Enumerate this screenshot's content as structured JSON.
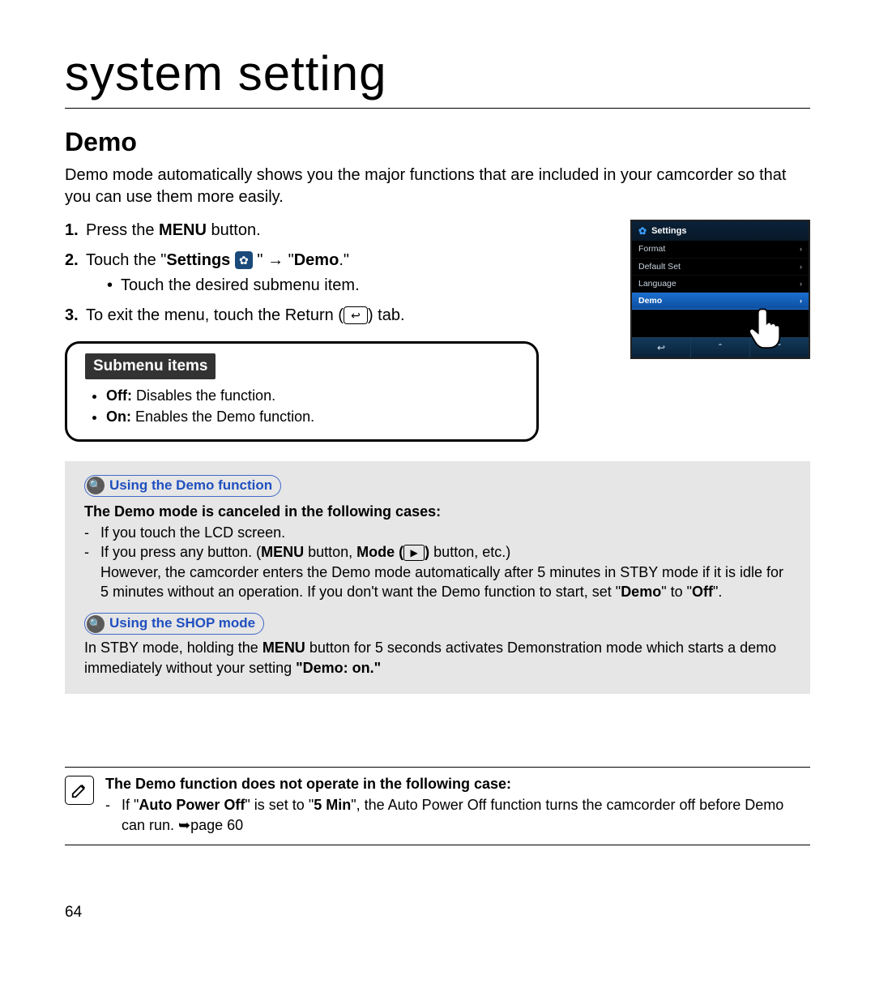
{
  "chapter": "system setting",
  "section": "Demo",
  "intro": "Demo mode automatically shows you the major functions that are included in your camcorder so that you can use them more easily.",
  "steps": {
    "s1_a": "Press the ",
    "s1_b": "MENU",
    "s1_c": " button.",
    "s2_a": "Touch the \"",
    "s2_b": "Settings",
    "s2_c": " \" → \"",
    "s2_d": "Demo",
    "s2_e": ".\"",
    "s2_sub": "Touch the desired submenu item.",
    "s3_a": "To exit the menu, touch the Return (",
    "s3_b": ") tab."
  },
  "submenu": {
    "label": "Submenu items",
    "off_b": "Off:",
    "off_t": " Disables the function.",
    "on_b": "On:",
    "on_t": " Enables the Demo function."
  },
  "info": {
    "pill1": "Using the Demo function",
    "cancel_intro": "The Demo mode is canceled in the following cases:",
    "c1": "If you touch the LCD screen.",
    "c2_a": "If you press any button. (",
    "c2_b": "MENU",
    "c2_c": " button, ",
    "c2_d": "Mode (",
    "c2_e": ")",
    "c2_f": " button, etc.)",
    "c2_note_a": "However, the camcorder enters the Demo mode automatically after 5 minutes in STBY mode if it is idle for 5 minutes without an operation. If you don't want the Demo function to start, set \"",
    "c2_note_b": "Demo",
    "c2_note_c": "\" to \"",
    "c2_note_d": "Off",
    "c2_note_e": "\".",
    "pill2": "Using the SHOP mode",
    "shop_a": "In STBY mode, holding the ",
    "shop_b": "MENU",
    "shop_c": " button for 5 seconds activates Demonstration mode which starts a demo immediately without your setting ",
    "shop_d": "\"Demo: on.\""
  },
  "note": {
    "title": "The Demo function does not operate in the following case:",
    "li_a": "If \"",
    "li_b": "Auto Power Off",
    "li_c": "\" is set to \"",
    "li_d": "5 Min",
    "li_e": "\", the Auto Power Off function turns the camcorder off before Demo can run. ➥page 60"
  },
  "camshot": {
    "title": "Settings",
    "r1": "Format",
    "r2": "Default Set",
    "r3": "Language",
    "r4": "Demo"
  },
  "pageNumber": "64"
}
